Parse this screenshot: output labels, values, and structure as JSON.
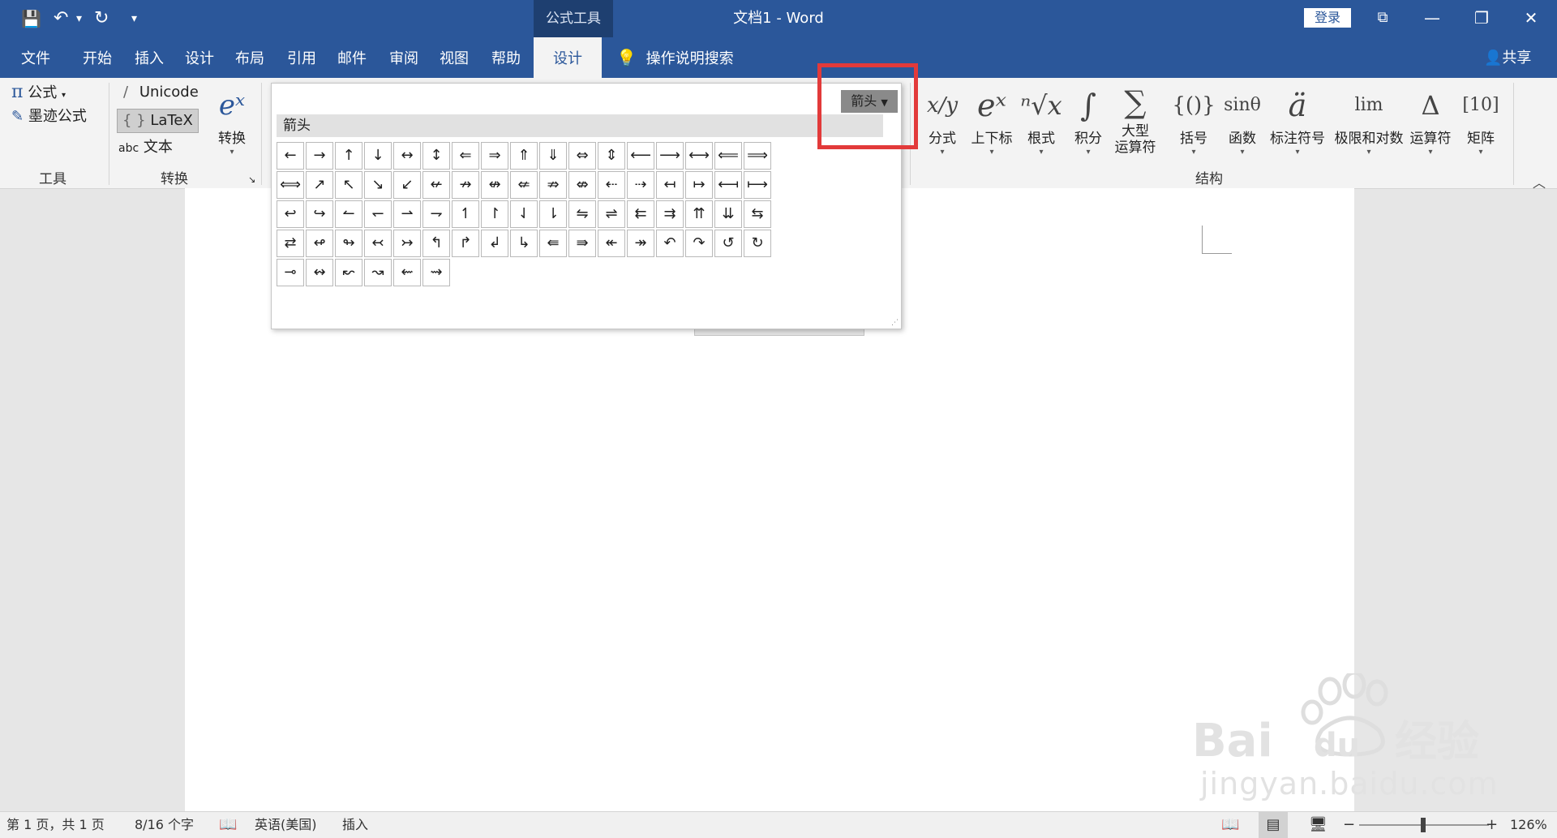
{
  "titlebar": {
    "context_tab": "公式工具",
    "title": "文档1  -  Word",
    "login": "登录",
    "qat": {
      "save": "💾",
      "undo": "↶",
      "undo_drop": "▾",
      "redo": "↻",
      "customize": "▾"
    },
    "window": {
      "restore_ribbon": "⧉",
      "minimize": "—",
      "maximize": "❐",
      "close": "✕"
    }
  },
  "tabs": [
    "文件",
    "开始",
    "插入",
    "设计",
    "布局",
    "引用",
    "邮件",
    "审阅",
    "视图",
    "帮助"
  ],
  "active_tab": "设计",
  "tell_me": "操作说明搜索",
  "share": "共享",
  "ribbon": {
    "tools": {
      "equation": "公式",
      "ink_equation": "墨迹公式",
      "label": "工具"
    },
    "conversions": {
      "unicode": "Unicode",
      "latex": "LaTeX",
      "text": "文本",
      "convert": "转换",
      "label": "转换"
    },
    "structures": {
      "label": "结构",
      "items": [
        {
          "glyph": "x/y",
          "label": "分式"
        },
        {
          "glyph": "eˣ",
          "label": "上下标"
        },
        {
          "glyph": "ⁿ√x",
          "label": "根式"
        },
        {
          "glyph": "∫",
          "label": "积分"
        },
        {
          "glyph": "∑",
          "label": "大型\n运算符"
        },
        {
          "glyph": "{()}",
          "label": "括号"
        },
        {
          "glyph": "sinθ",
          "label": "函数"
        },
        {
          "glyph": "ä",
          "label": "标注符号"
        },
        {
          "glyph": "lim",
          "label": "极限和对数"
        },
        {
          "glyph": "Δ",
          "label": "运算符"
        },
        {
          "glyph": "[10]",
          "label": "矩阵"
        }
      ]
    }
  },
  "gallery": {
    "dropdown": "箭头",
    "header": "箭头",
    "symbols": [
      "←",
      "→",
      "↑",
      "↓",
      "↔",
      "↕",
      "⇐",
      "⇒",
      "⇑",
      "⇓",
      "⇔",
      "⇕",
      "⟵",
      "⟶",
      "⟷",
      "⟸",
      "⟹",
      "⟺",
      "↗",
      "↖",
      "↘",
      "↙",
      "↚",
      "↛",
      "↮",
      "⇍",
      "⇏",
      "⇎",
      "⇠",
      "⇢",
      "↤",
      "↦",
      "⟻",
      "⟼",
      "↩",
      "↪",
      "↼",
      "↽",
      "⇀",
      "⇁",
      "↿",
      "↾",
      "⇃",
      "⇂",
      "⇋",
      "⇌",
      "⇇",
      "⇉",
      "⇈",
      "⇊",
      "⇆",
      "⇄",
      "↫",
      "↬",
      "↢",
      "↣",
      "↰",
      "↱",
      "↲",
      "↳",
      "⇚",
      "⇛",
      "↞",
      "↠",
      "↶",
      "↷",
      "↺",
      "↻",
      "⊸",
      "↭",
      "↜",
      "↝",
      "⇜",
      "⇝"
    ]
  },
  "status": {
    "page": "第 1 页，共 1 页",
    "words": "8/16 个字",
    "language": "英语(美国)",
    "mode": "插入",
    "zoom_minus": "−",
    "zoom_plus": "+",
    "zoom": "126%"
  },
  "watermark": {
    "text": "jingyan.baidu.com"
  }
}
